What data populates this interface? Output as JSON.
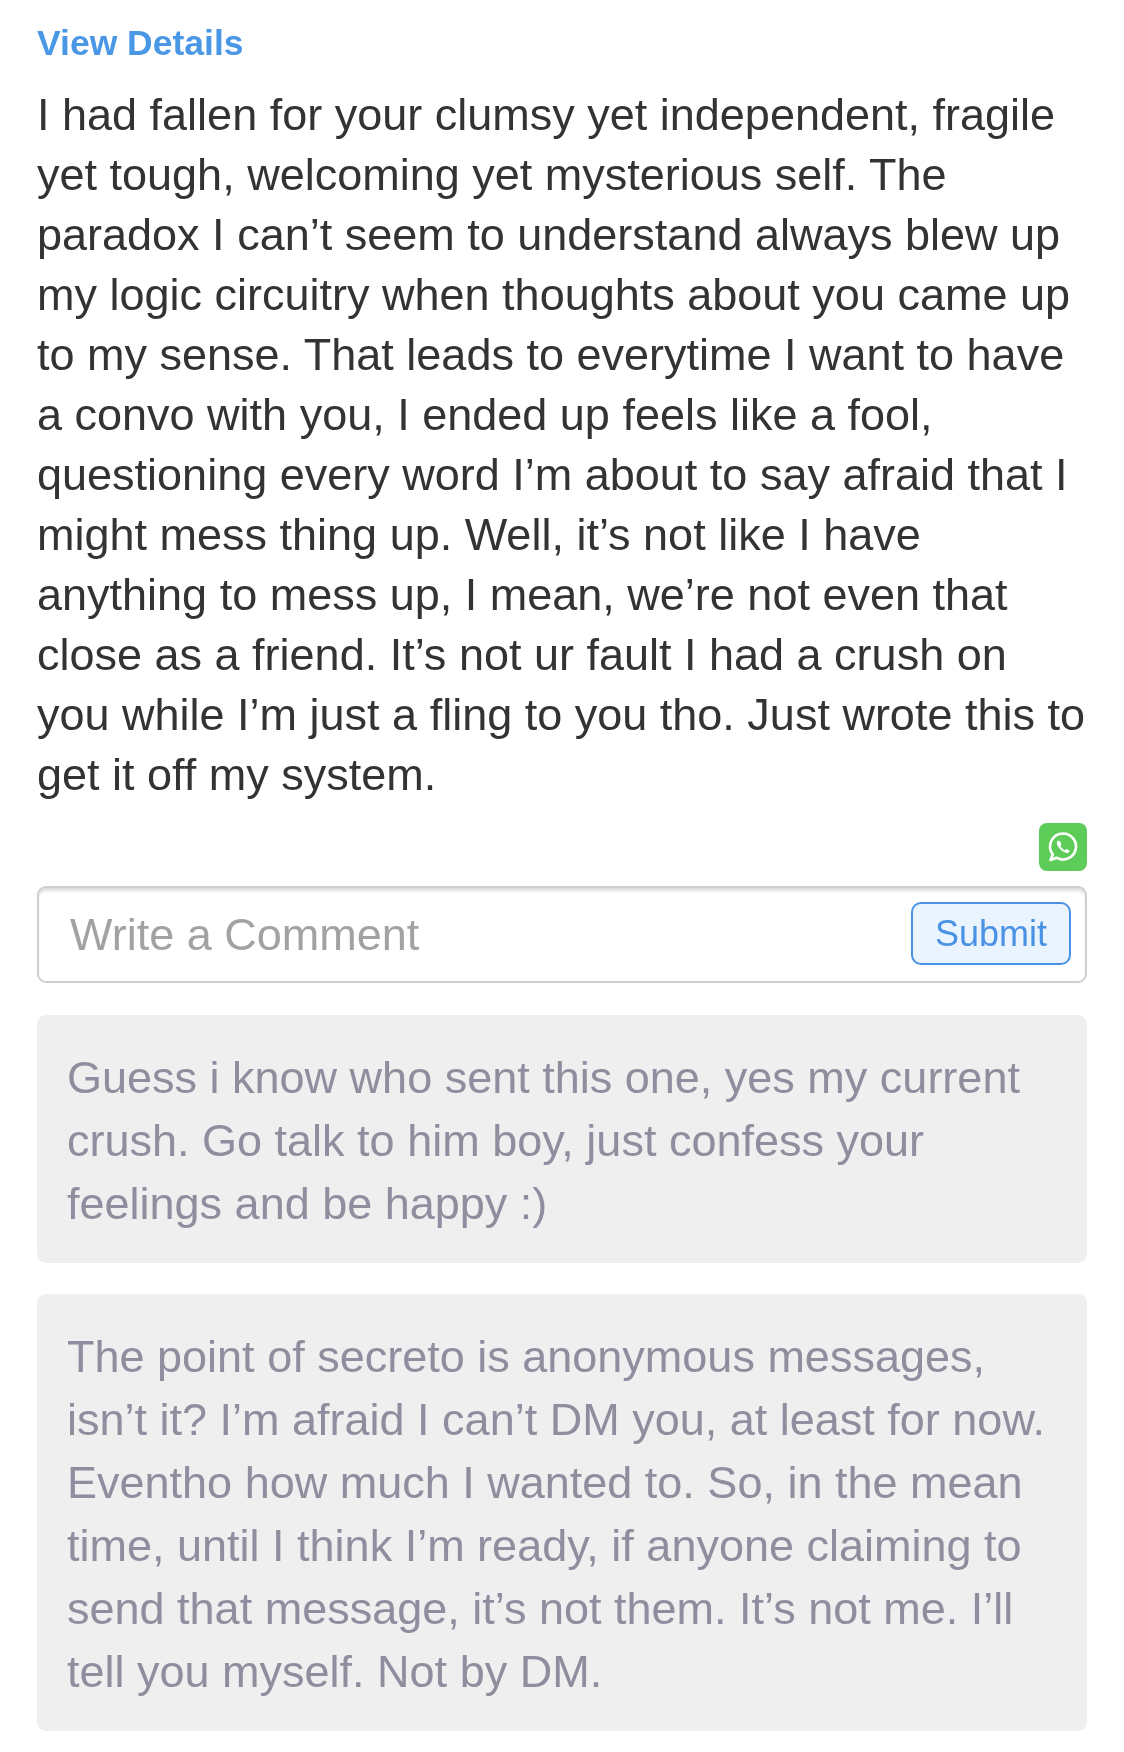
{
  "header": {
    "link": "View Details"
  },
  "post": {
    "text": "I had fallen for your clumsy yet independent, fragile yet tough, welcoming yet mysterious self. The paradox I can’t seem to understand always blew up my logic circuitry when thoughts about you came up to my sense. That leads to everytime I want to have a convo with you, I ended up feels like a fool, questioning every word I’m about to say afraid that I might mess thing up. Well, it’s not like I have anything to mess up, I mean, we’re not even that close as a friend. It’s not ur fault I had a crush on you while I’m just a fling to you tho. Just wrote this to get it off my system."
  },
  "comment_form": {
    "placeholder": "Write a Comment",
    "submit": "Submit"
  },
  "comments": [
    {
      "text": "Guess i know who sent this one, yes my current crush. Go talk to him boy, just confess your feelings and be happy :)"
    },
    {
      "text": "The point of secreto is anonymous messages, isn’t it? I’m afraid I can’t DM you, at least for now. Eventho how much I wanted to. So, in the mean time, until I think I’m ready, if anyone claiming to send that message, it’s not them. It’s not me. I’ll tell you myself. Not by DM."
    }
  ]
}
